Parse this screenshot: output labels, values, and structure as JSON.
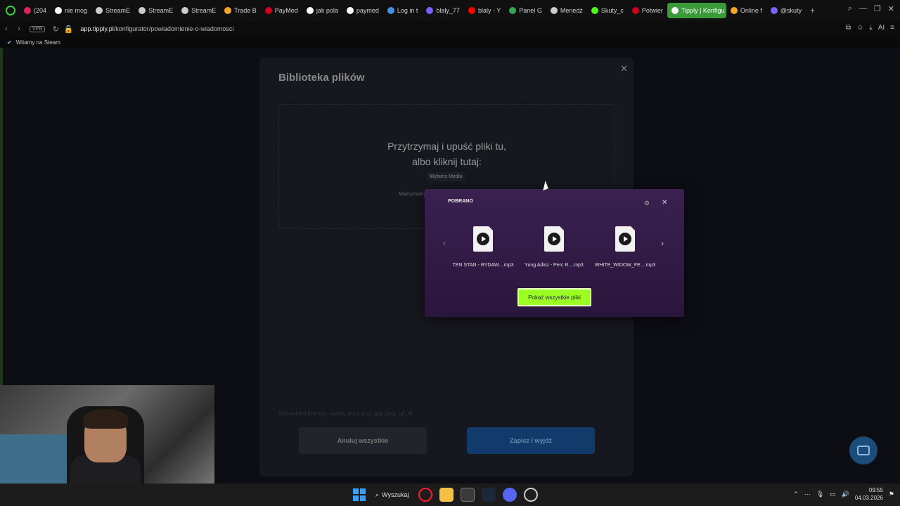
{
  "browser": {
    "tabs": [
      {
        "label": "(204",
        "color": "#e0245e"
      },
      {
        "label": "nie mog",
        "color": "#ffffff"
      },
      {
        "label": "StreamE",
        "color": "#cccccc"
      },
      {
        "label": "StreamE",
        "color": "#cccccc"
      },
      {
        "label": "StreamE",
        "color": "#cccccc"
      },
      {
        "label": "Trade B",
        "color": "#f5a623"
      },
      {
        "label": "PayMed",
        "color": "#d0021b"
      },
      {
        "label": "jak pola",
        "color": "#ffffff"
      },
      {
        "label": "paymed",
        "color": "#ffffff"
      },
      {
        "label": "Log in t",
        "color": "#4a90e2"
      },
      {
        "label": "blaly_77",
        "color": "#7b61ff"
      },
      {
        "label": "blaly - Y",
        "color": "#ff0000"
      },
      {
        "label": "Panel G",
        "color": "#34a853"
      },
      {
        "label": "Menedż",
        "color": "#cccccc"
      },
      {
        "label": "Skuty_c",
        "color": "#53fc18"
      },
      {
        "label": "Potwier",
        "color": "#d0021b"
      }
    ],
    "active_tab": "Tipply | Konfigu",
    "tabs_after": [
      {
        "label": "Online f",
        "color": "#f5a623"
      },
      {
        "label": "@skuty",
        "color": "#7b61ff"
      }
    ],
    "vpn_label": "VPN",
    "url_domain": "app.tipply.pl",
    "url_path": "/konfigurator/powiadomienie-o-wiadomosci",
    "ai_label": "AI",
    "bookmark": "Witamy na Steam"
  },
  "modal": {
    "title": "Biblioteka plików",
    "dropzone_line1": "Przytrzymaj i upuść pliki tu,",
    "dropzone_line2": "albo kliknij tutaj:",
    "choose_media": "Wybierz Media",
    "max_size": "Maksymalny",
    "formats": "Dozwolone formaty: webm, mp3, png, jpg, jpeg, gif, ttf",
    "cancel_label": "Anuluj wszystkie",
    "save_label": "Zapisz i wyjdź"
  },
  "downloads": {
    "title": "POBRANO",
    "files": [
      {
        "name": "TEN STAN - RYDAW....mp3"
      },
      {
        "name": "Yung Adisz - Perc R....mp3"
      },
      {
        "name": "WHITE_WIDOW_FE....mp3"
      }
    ],
    "show_all_label": "Pokaż wszystkie pliki"
  },
  "taskbar": {
    "search_label": "Wyszukaj",
    "time": "09:55",
    "date": "04.03.2026"
  }
}
